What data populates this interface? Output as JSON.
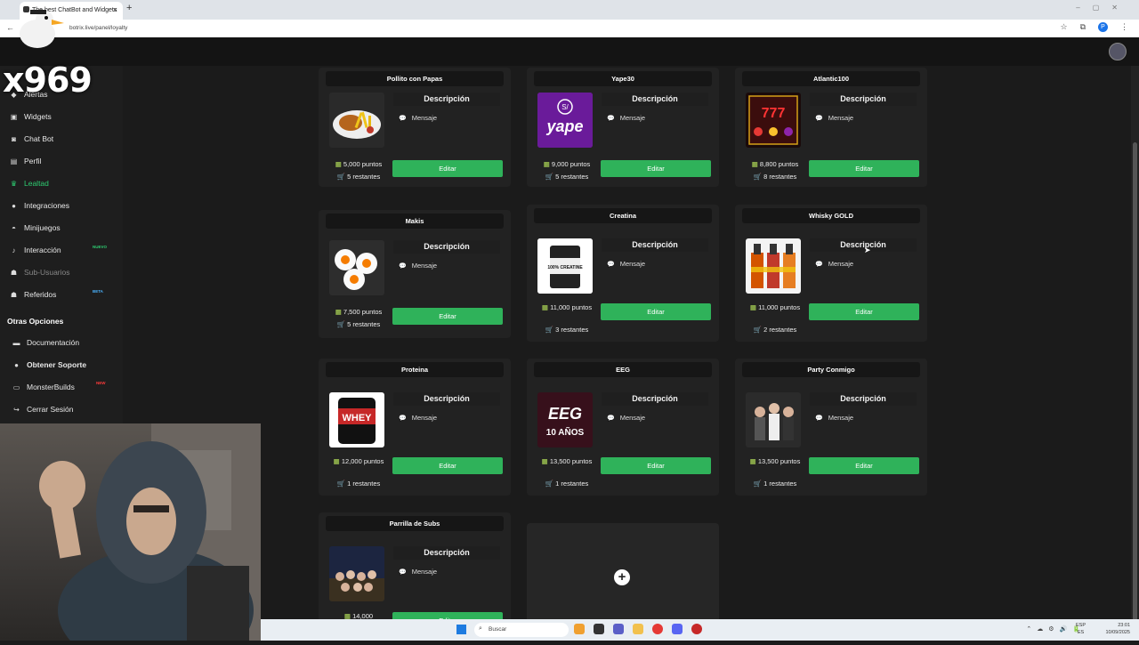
{
  "browser": {
    "tab_title": "The best ChatBot and Widgets",
    "url": "botrix.live/panel/loyalty"
  },
  "overlay": {
    "watermark": "x969"
  },
  "sidebar": {
    "items": [
      {
        "label": "Alertas",
        "icon": "bell-icon"
      },
      {
        "label": "Widgets",
        "icon": "puzzle-icon"
      },
      {
        "label": "Chat Bot",
        "icon": "robot-icon"
      },
      {
        "label": "Perfil",
        "icon": "profile-icon"
      },
      {
        "label": "Lealtad",
        "icon": "trophy-icon"
      },
      {
        "label": "Integraciones",
        "icon": "plug-icon"
      },
      {
        "label": "Minijuegos",
        "icon": "gamepad-icon"
      },
      {
        "label": "Interacción",
        "icon": "music-icon",
        "badge": "NUEVO"
      },
      {
        "label": "Sub-Usuarios",
        "icon": "users-icon"
      },
      {
        "label": "Referidos",
        "icon": "users-icon",
        "badge": "BETA"
      }
    ],
    "other_header": "Otras Opciones",
    "other_items": [
      {
        "label": "Documentación",
        "icon": "document-icon"
      },
      {
        "label": "Obtener Soporte",
        "icon": "support-icon"
      },
      {
        "label": "MonsterBuilds",
        "icon": "monitor-icon",
        "badge": "NEW"
      },
      {
        "label": "Cerrar Sesión",
        "icon": "logout-icon"
      }
    ],
    "accent": "#2ecc71"
  },
  "rewards": {
    "desc_title": "Descripción",
    "msg_label": "Mensaje",
    "edit_label": "Editar",
    "items": [
      {
        "title": "Pollito con Papas",
        "points": "5,000 puntos",
        "remaining": "5 restantes"
      },
      {
        "title": "Yape30",
        "points": "9,000 puntos",
        "remaining": "5 restantes"
      },
      {
        "title": "Atlantic100",
        "points": "8,800 puntos",
        "remaining": "8 restantes"
      },
      {
        "title": "Makis",
        "points": "7,500 puntos",
        "remaining": "5 restantes"
      },
      {
        "title": "Creatina",
        "points": "11,000 puntos",
        "remaining": "3 restantes"
      },
      {
        "title": "Whisky GOLD",
        "points": "11,000 puntos",
        "remaining": "2 restantes"
      },
      {
        "title": "Proteina",
        "points": "12,000 puntos",
        "remaining": "1 restantes"
      },
      {
        "title": "EEG",
        "points": "13,500 puntos",
        "remaining": "1 restantes"
      },
      {
        "title": "Party Conmigo",
        "points": "13,500 puntos",
        "remaining": "1 restantes"
      },
      {
        "title": "Parrilla de Subs",
        "points": "14,000",
        "remaining": ""
      }
    ],
    "img_texts": {
      "yape": "yape",
      "yape_badge": "S/",
      "creatine": "100% CREATINE",
      "whey": "WHEY",
      "eeg": "EEG",
      "eeg_sub": "10 AÑOS",
      "slots": "777"
    }
  },
  "taskbar": {
    "search_placeholder": "Buscar",
    "lang_top": "ESP",
    "lang_bottom": "ES",
    "time": "23:01",
    "date": "10/09/2025"
  }
}
